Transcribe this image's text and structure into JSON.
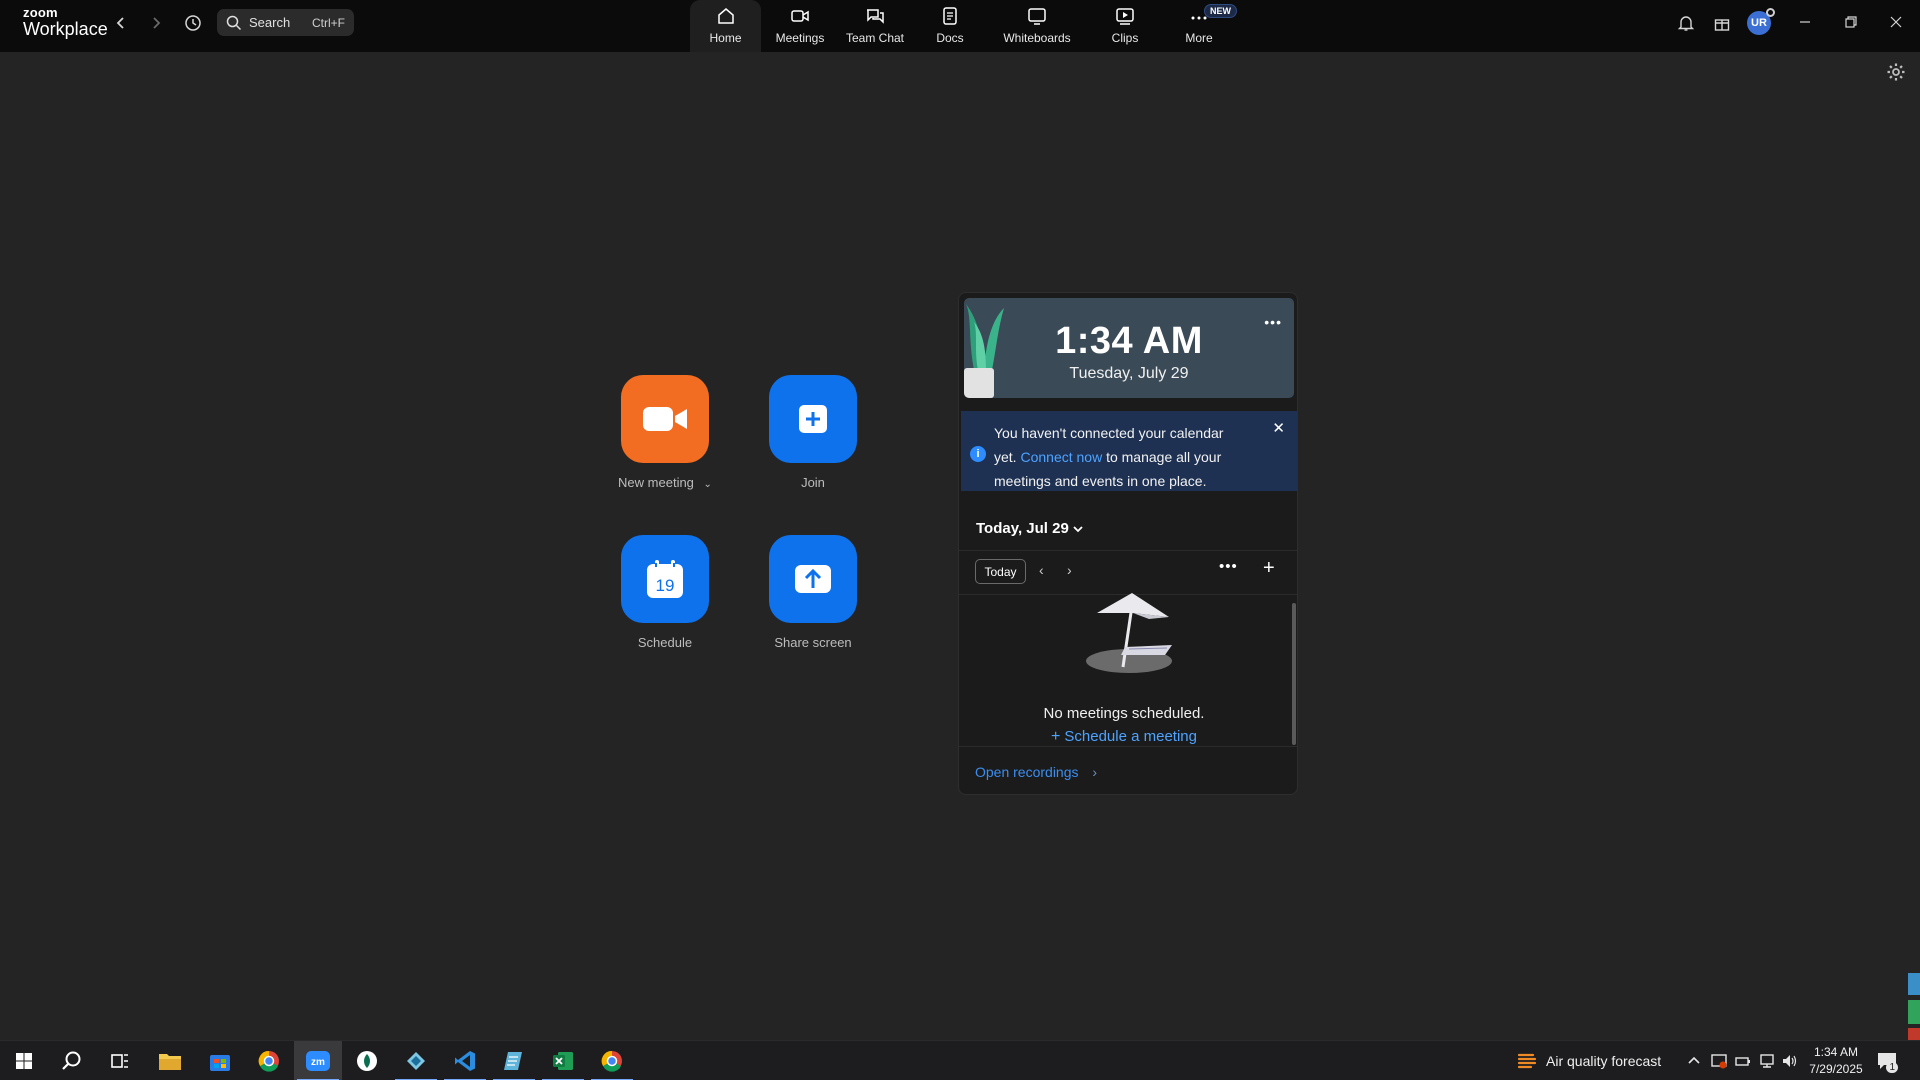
{
  "app": {
    "logo_line1": "zoom",
    "logo_line2": "Workplace",
    "search_placeholder": "Search",
    "search_shortcut": "Ctrl+F",
    "avatar_initials": "UR"
  },
  "nav": [
    {
      "label": "Home",
      "icon": "home-icon",
      "active": true
    },
    {
      "label": "Meetings",
      "icon": "video-camera-icon"
    },
    {
      "label": "Team Chat",
      "icon": "chat-icon"
    },
    {
      "label": "Docs",
      "icon": "document-icon"
    },
    {
      "label": "Whiteboards",
      "icon": "whiteboard-icon"
    },
    {
      "label": "Clips",
      "icon": "clips-icon"
    },
    {
      "label": "More",
      "icon": "more-icon",
      "badge": "NEW"
    }
  ],
  "actions": {
    "new_meeting": "New meeting",
    "join": "Join",
    "schedule": "Schedule",
    "schedule_day": "19",
    "share_screen": "Share screen"
  },
  "calendar_panel": {
    "time": "1:34 AM",
    "date": "Tuesday, July 29",
    "notice_before": "You haven't connected your calendar yet. ",
    "notice_link": "Connect now",
    "notice_after": " to manage all your meetings and events in one place.",
    "day_label": "Today, Jul 29",
    "today_button": "Today",
    "empty_message": "No meetings scheduled.",
    "schedule_link": "Schedule a meeting",
    "open_recordings": "Open recordings"
  },
  "taskbar": {
    "weather": "Air quality forecast",
    "time": "1:34 AM",
    "date": "7/29/2025",
    "notification_count": "1"
  },
  "colors": {
    "accent_blue": "#0e72ed",
    "accent_orange": "#f26d21",
    "link_blue": "#4da3ff",
    "notice_bg": "#1e3153"
  }
}
